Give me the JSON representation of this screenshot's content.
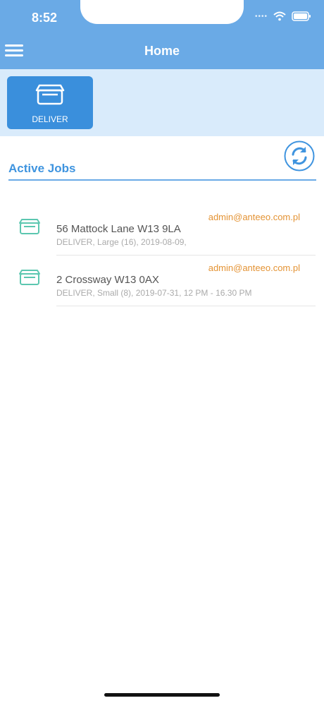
{
  "status_bar": {
    "time": "8:52"
  },
  "header": {
    "title": "Home"
  },
  "actions": {
    "deliver_label": "DELIVER"
  },
  "active_jobs": {
    "title": "Active Jobs",
    "items": [
      {
        "email": "admin@anteeo.com.pl",
        "address": "56 Mattock Lane W13 9LA",
        "meta": "DELIVER, Large (16), 2019-08-09,"
      },
      {
        "email": "admin@anteeo.com.pl",
        "address": "2 Crossway W13 0AX",
        "meta": "DELIVER, Small (8), 2019-07-31, 12 PM - 16.30 PM"
      }
    ]
  },
  "colors": {
    "header": "#6aaae6",
    "action_band": "#d9ebfb",
    "deliver_button": "#3a8fdc",
    "email": "#e49334",
    "job_icon": "#5cc7b0"
  },
  "icons": [
    "hamburger-menu-icon",
    "box-icon",
    "refresh-icon",
    "wifi-icon",
    "battery-icon"
  ]
}
